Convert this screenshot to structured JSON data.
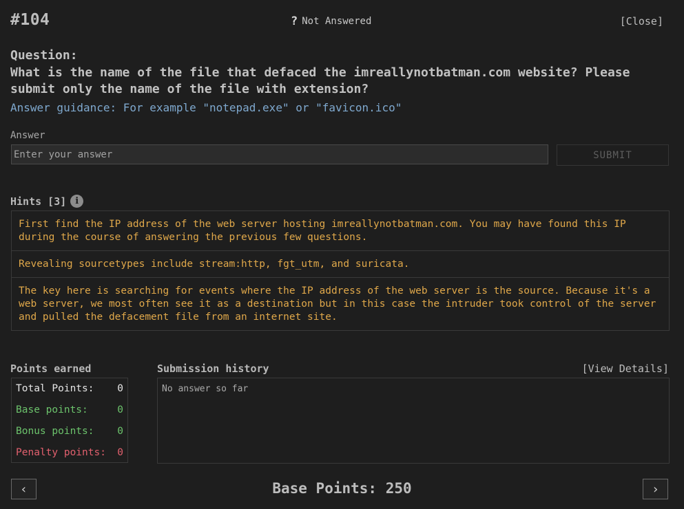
{
  "header": {
    "question_number": "#104",
    "status_icon": "?",
    "status_text": "Not Answered",
    "close_label": "[Close]"
  },
  "question": {
    "label": "Question:",
    "text": "What is the name of the file that defaced the imreallynotbatman.com website? Please submit only the name of the file with extension?",
    "guidance": "Answer guidance: For example \"notepad.exe\" or \"favicon.ico\""
  },
  "answer": {
    "label": "Answer",
    "value": "",
    "placeholder": "Enter your answer",
    "submit_label": "SUBMIT"
  },
  "hints": {
    "label": "Hints [3]",
    "info_icon": "info-icon",
    "items": [
      "First find the IP address of the web server hosting imreallynotbatman.com. You may have found this IP during the course of answering the previous few questions.",
      "Revealing sourcetypes include stream:http, fgt_utm, and suricata.",
      "The key here is searching for events where the IP address of the web server is the source. Because it's a web server, we most often see it as a destination but in this case the intruder took control of the server and pulled the defacement file from an internet site."
    ]
  },
  "points": {
    "label": "Points earned",
    "total_label": "Total Points:",
    "total_value": "0",
    "base_label": "Base points:",
    "base_value": "0",
    "bonus_label": "Bonus points:",
    "bonus_value": "0",
    "penalty_label": "Penalty points:",
    "penalty_value": "0"
  },
  "history": {
    "label": "Submission history",
    "view_details": "[View Details]",
    "empty_text": "No answer so far"
  },
  "footer": {
    "prev_icon": "‹",
    "next_icon": "›",
    "base_points": "Base Points: 250"
  },
  "colors": {
    "background": "#1e1e1e",
    "hint_text": "#e0a84a",
    "guidance_text": "#7fa9cf",
    "positive_points": "#6cc36c",
    "penalty_points": "#e2606e"
  }
}
